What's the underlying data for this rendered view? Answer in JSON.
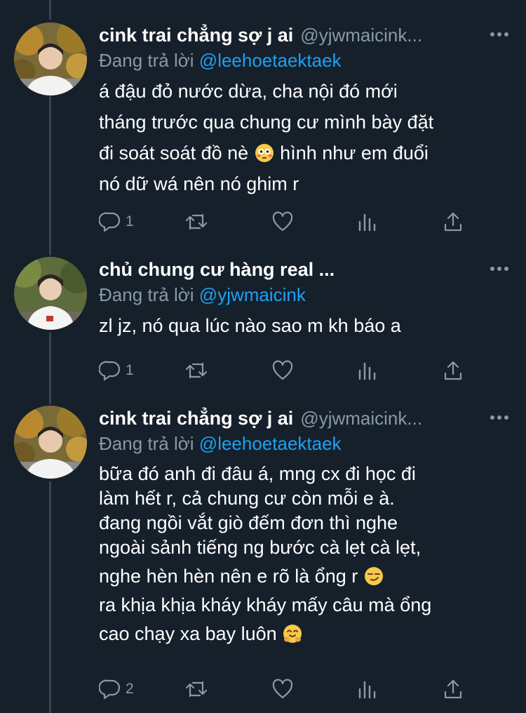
{
  "tweets": [
    {
      "name": "cink trai chẳng sợ j ai",
      "handle": "@yjwmaicink...",
      "replying_prefix": "Đang trả lời",
      "replying_to": "@leehoetaektaek",
      "lines": [
        "á đậu đỏ nước dừa, cha nội đó mới",
        "tháng trước qua chung cư mình bày đặt",
        "đi soát soát đồ nè",
        "nó dữ wá nên nó ghim r"
      ],
      "line3_after_emoji": " hình như em đuổi",
      "emoji_1": "flushed-face-emoji",
      "reply_count": "1",
      "avatar": "avatar-photo-autumn"
    },
    {
      "name": "chủ chung cư hàng real ...",
      "handle": "",
      "replying_prefix": "Đang trả lời",
      "replying_to": "@yjwmaicink",
      "lines": [
        "zl jz, nó qua lúc nào sao m kh báo a"
      ],
      "reply_count": "1",
      "avatar": "avatar-photo-white-shirt"
    },
    {
      "name": "cink trai chẳng sợ j ai",
      "handle": "@yjwmaicink...",
      "replying_prefix": "Đang trả lời",
      "replying_to": "@leehoetaektaek",
      "lines": [
        "bữa đó anh đi đâu á, mng cx đi học đi",
        "làm hết r, cả chung cư còn mỗi e à.",
        "đang ngồi vắt giò đếm đơn thì nghe",
        "ngoài sảnh tiếng ng bước cà lẹt cà lẹt,",
        "nghe hèn hèn nên e rõ là ổng r",
        "ra khịa khịa kháy kháy mấy câu mà ổng",
        "cao chạy xa bay luôn"
      ],
      "emoji_2": "smirking-face-emoji",
      "emoji_3": "hugging-face-emoji",
      "reply_count": "2",
      "avatar": "avatar-photo-autumn"
    }
  ],
  "colors": {
    "background": "#15202b",
    "text": "#ffffff",
    "secondary": "#8899a6",
    "link": "#1da1f2",
    "thread_line": "#38444d"
  }
}
